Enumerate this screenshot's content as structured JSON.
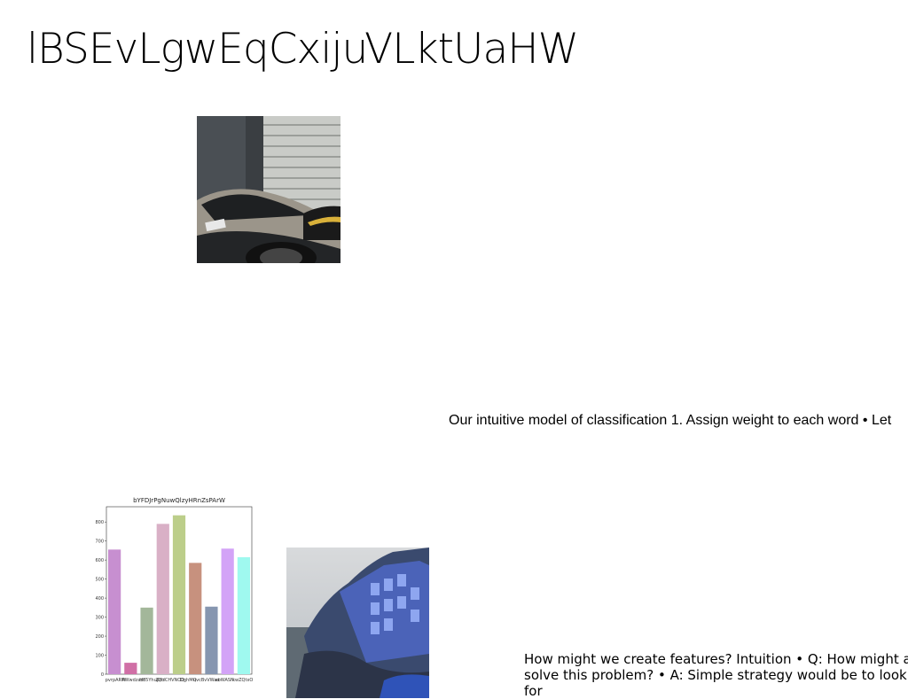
{
  "slide": {
    "title": "lBSEvLgwEqCxijuVLktUaHW"
  },
  "images": {
    "car_photo": "photo-car",
    "coast_photo": "photo-coast"
  },
  "captions": {
    "first": "Our intuitive model of classification 1. Assign weight to each word • Let",
    "second": "How might we create features? Intuition • Q: How might a solve this problem? • A: Simple strategy would be to look for"
  },
  "chart_data": {
    "type": "bar",
    "title": "bYFDJrPgNuwQlzyHRnZsPArW",
    "categories": [
      "pvrpARW",
      "PWwdzazc",
      "H85YhujQu",
      "ZdHCHVNOD",
      "DghMQ",
      "uvcBvVWad",
      "aoWASN",
      "kwZQtxO"
    ],
    "values": [
      655,
      60,
      350,
      790,
      835,
      585,
      355,
      660,
      615
    ],
    "colors": [
      "#c78fd0",
      "#d06fa6",
      "#a3b79a",
      "#d9b0c6",
      "#bcce8a",
      "#c7917e",
      "#8696b0",
      "#d3a3f7",
      "#9ff9ef"
    ],
    "ylim": [
      0,
      880
    ],
    "yticks": [
      "0",
      "100",
      "200",
      "300",
      "400",
      "500",
      "600",
      "700",
      "800"
    ]
  }
}
